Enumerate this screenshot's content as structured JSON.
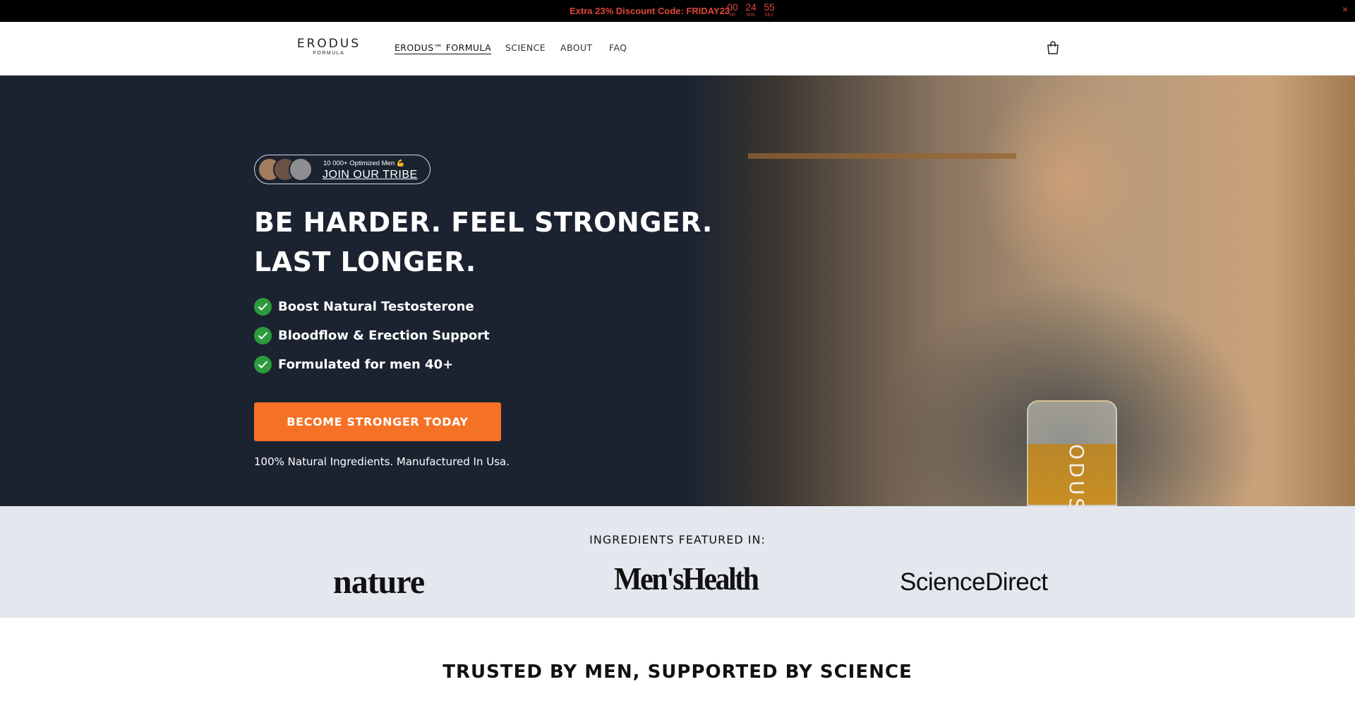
{
  "announcement": {
    "text": "Extra 23% Discount Code: FRIDAY23",
    "timer": [
      {
        "value": "00",
        "unit": "HR"
      },
      {
        "value": "24",
        "unit": "MIN"
      },
      {
        "value": "55",
        "unit": "SEC"
      }
    ],
    "close": "×",
    "color": "#e0463a"
  },
  "header": {
    "logo": {
      "main": "ERODUS",
      "sub": "FORMULA"
    },
    "nav": [
      "ERODUS™ FORMULA",
      "SCIENCE",
      "ABOUT",
      "FAQ"
    ],
    "active_nav": "ERODUS™ FORMULA",
    "cart_icon": "cart-icon"
  },
  "hero": {
    "tribe": {
      "small": "10 000+ Optimized Men 💪",
      "big": "JOIN OUR TRIBE"
    },
    "headline_line1": "BE HARDER. FEEL STRONGER.",
    "headline_line2": "LAST LONGER.",
    "benefits": [
      "Boost Natural Testosterone",
      "Bloodflow & Erection Support",
      "Formulated for men 40+"
    ],
    "cta": "BECOME STRONGER TODAY",
    "natural_note": "100% Natural Ingredients. Manufactured In Usa.",
    "jar_label": "ODUS",
    "accent_color": "#f47125",
    "check_color": "#2d9a3e",
    "background": "#1b2331"
  },
  "featured": {
    "title": "INGREDIENTS FEATURED IN:",
    "brands": [
      "nature",
      "Men'sHealth",
      "ScienceDirect"
    ]
  },
  "trusted_title": "TRUSTED BY MEN, SUPPORTED BY SCIENCE"
}
